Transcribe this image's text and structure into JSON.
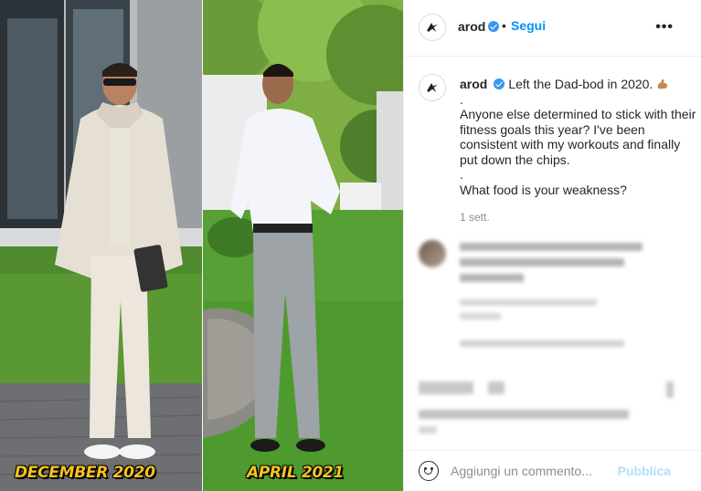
{
  "photo": {
    "left_caption": "DECEMBER 2020",
    "right_caption": "APRIL 2021"
  },
  "header": {
    "username": "arod",
    "separator": "•",
    "follow_label": "Segui",
    "more_icon": "more-horizontal-icon"
  },
  "post": {
    "username": "arod",
    "lines": [
      "Left the Dad-bod in 2020.",
      ".",
      "Anyone else determined to stick with their fitness goals this year? I've been consistent with my workouts and finally put down the chips.",
      ".",
      "What food is your weakness?"
    ],
    "emoji": "flexed-biceps-icon",
    "timestamp": "1 sett."
  },
  "composer": {
    "placeholder": "Aggiungi un commento...",
    "publish_label": "Pubblica",
    "emoji_icon": "smiley-icon"
  },
  "colors": {
    "accent": "#0095f6",
    "verified": "#3897f0",
    "caption_yellow": "#f6c21c",
    "publish_disabled": "#b2dffc"
  }
}
